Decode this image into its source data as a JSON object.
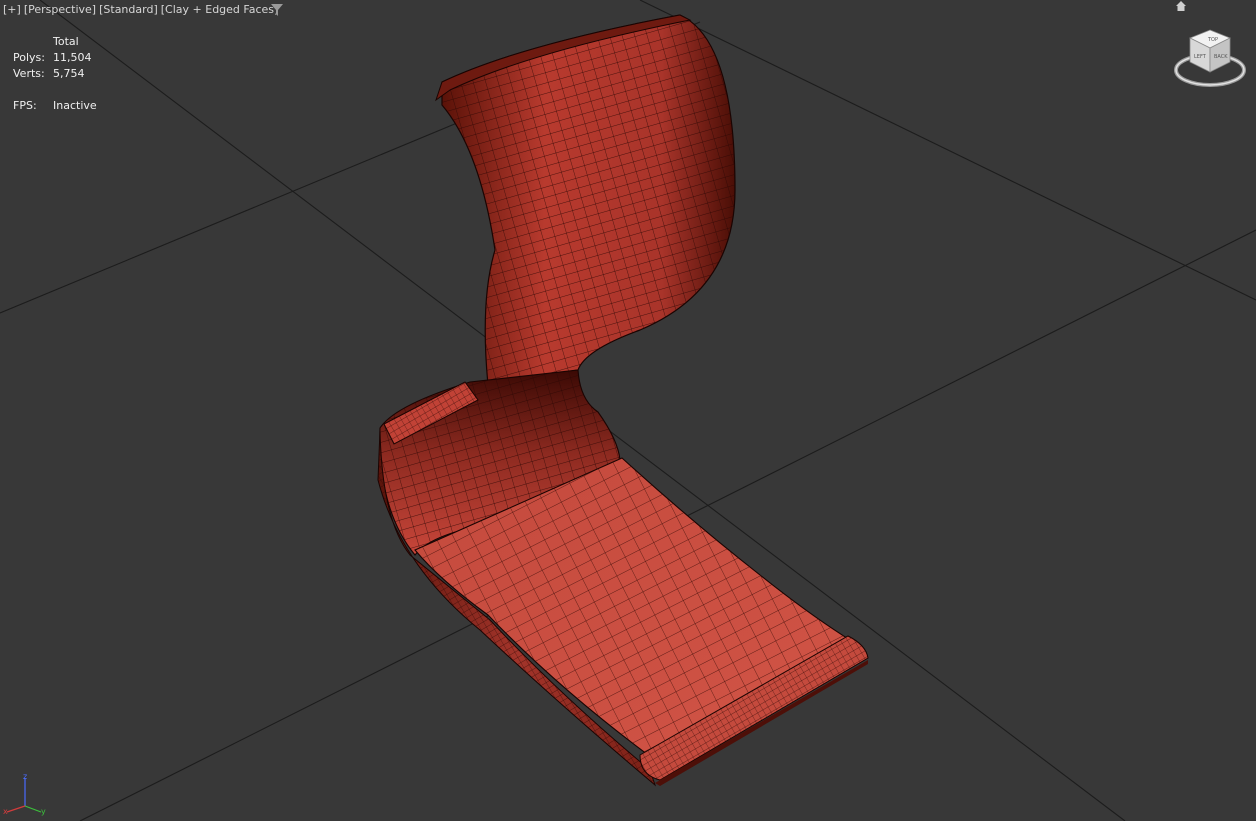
{
  "viewport": {
    "labels": [
      "[+]",
      "[Perspective]",
      "[Standard]",
      "[Clay + Edged Faces]"
    ],
    "filter_icon": "funnel-icon",
    "background": "#383838",
    "grid_color": "#1c1c1c",
    "object_color": "#c9483c"
  },
  "stats": {
    "header": "Total",
    "polys_label": "Polys:",
    "polys_value": "11,504",
    "verts_label": "Verts:",
    "verts_value": "5,754",
    "fps_label": "FPS:",
    "fps_value": "Inactive"
  },
  "viewcube": {
    "faces": [
      "TOP",
      "LEFT",
      "BACK"
    ],
    "icon": "viewcube-icon",
    "home_icon": "home-icon"
  },
  "axis_tripod": {
    "axes": [
      "z",
      "x",
      "y"
    ],
    "colors": {
      "x": "#d23c3c",
      "y": "#3cc13c",
      "z": "#4a6cff"
    }
  }
}
